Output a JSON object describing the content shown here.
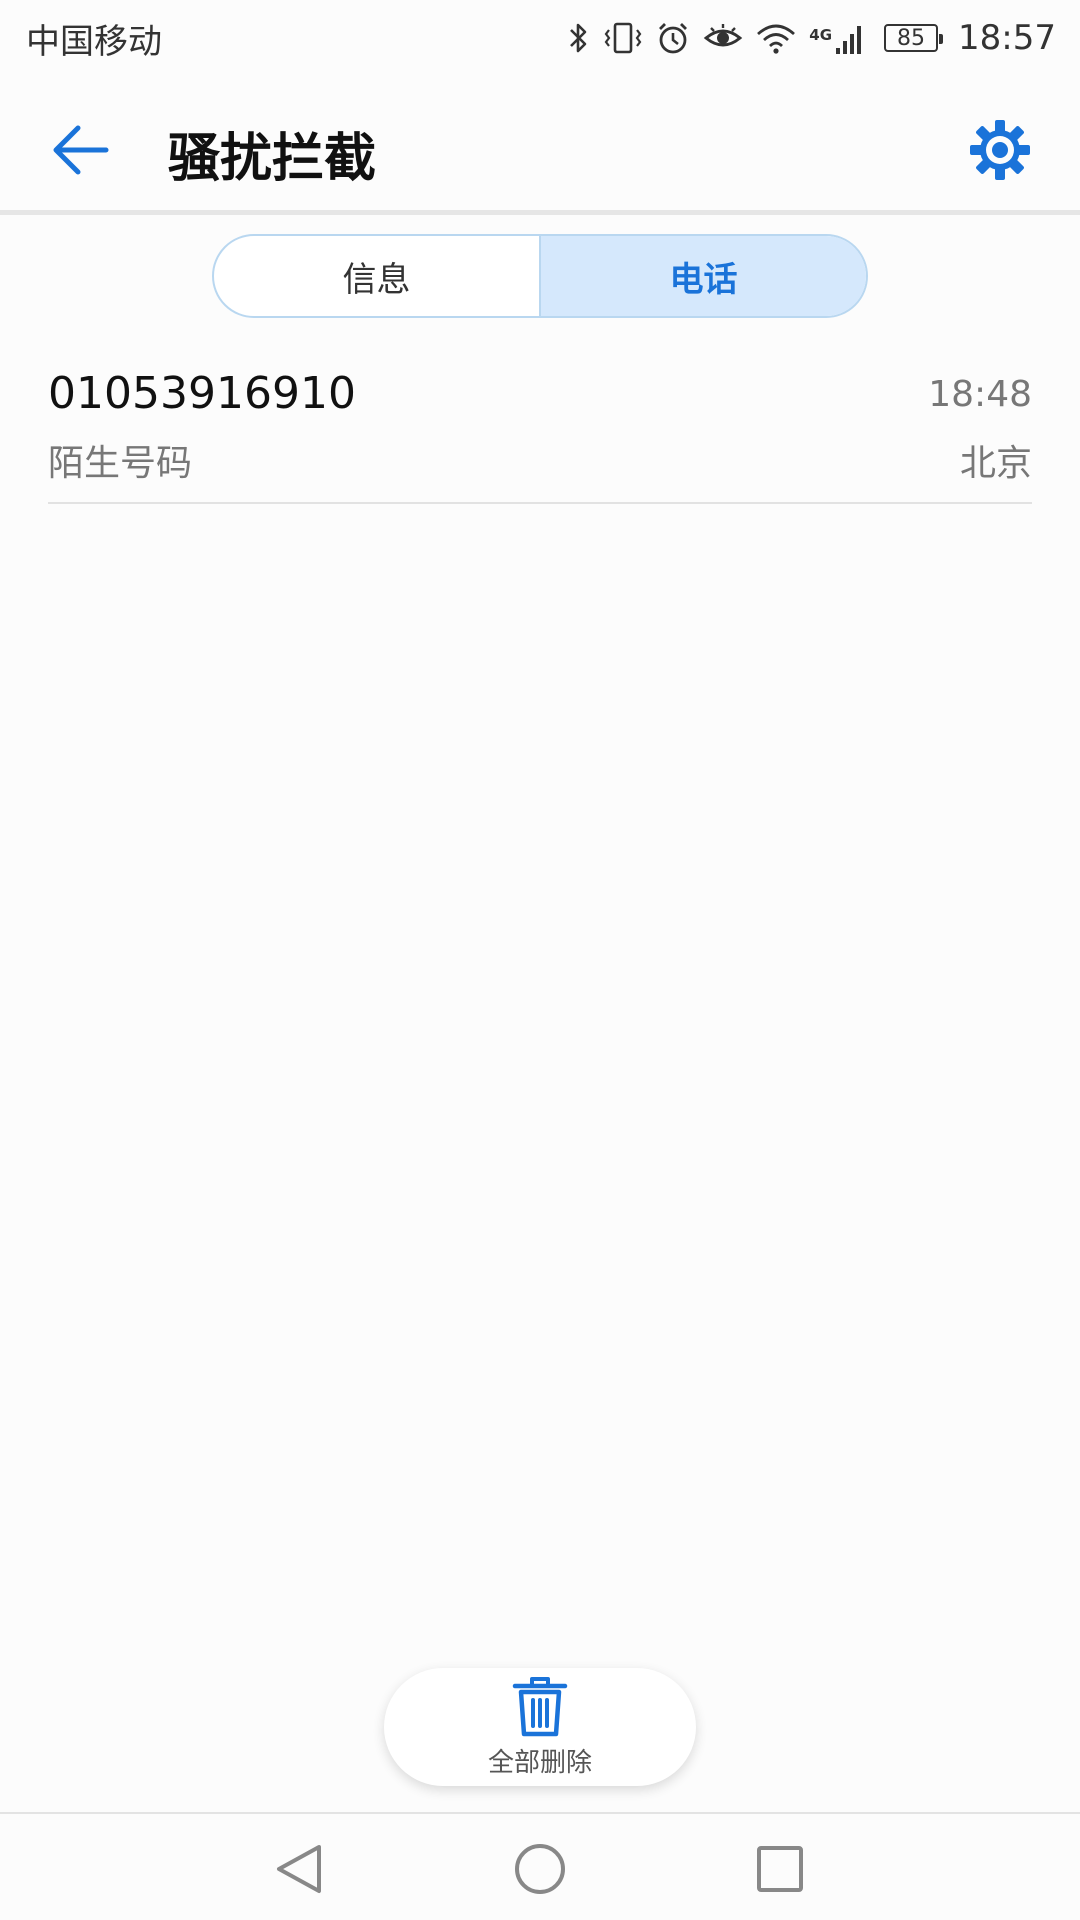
{
  "status_bar": {
    "carrier": "中国移动",
    "network": "4G",
    "battery": "85",
    "time": "18:57"
  },
  "app_bar": {
    "title": "骚扰拦截",
    "back_icon": "arrow-left-icon",
    "settings_icon": "gear-icon",
    "accent_color": "#1a73d9"
  },
  "tabs": [
    {
      "label": "信息",
      "active": false
    },
    {
      "label": "电话",
      "active": true
    }
  ],
  "calls": [
    {
      "number": "01053916910",
      "label": "陌生号码",
      "time": "18:48",
      "location": "北京"
    }
  ],
  "delete_all": {
    "label": "全部删除",
    "icon": "trash-icon"
  },
  "nav_bar": {
    "back_icon": "triangle-back-icon",
    "home_icon": "circle-home-icon",
    "recents_icon": "square-recents-icon"
  }
}
